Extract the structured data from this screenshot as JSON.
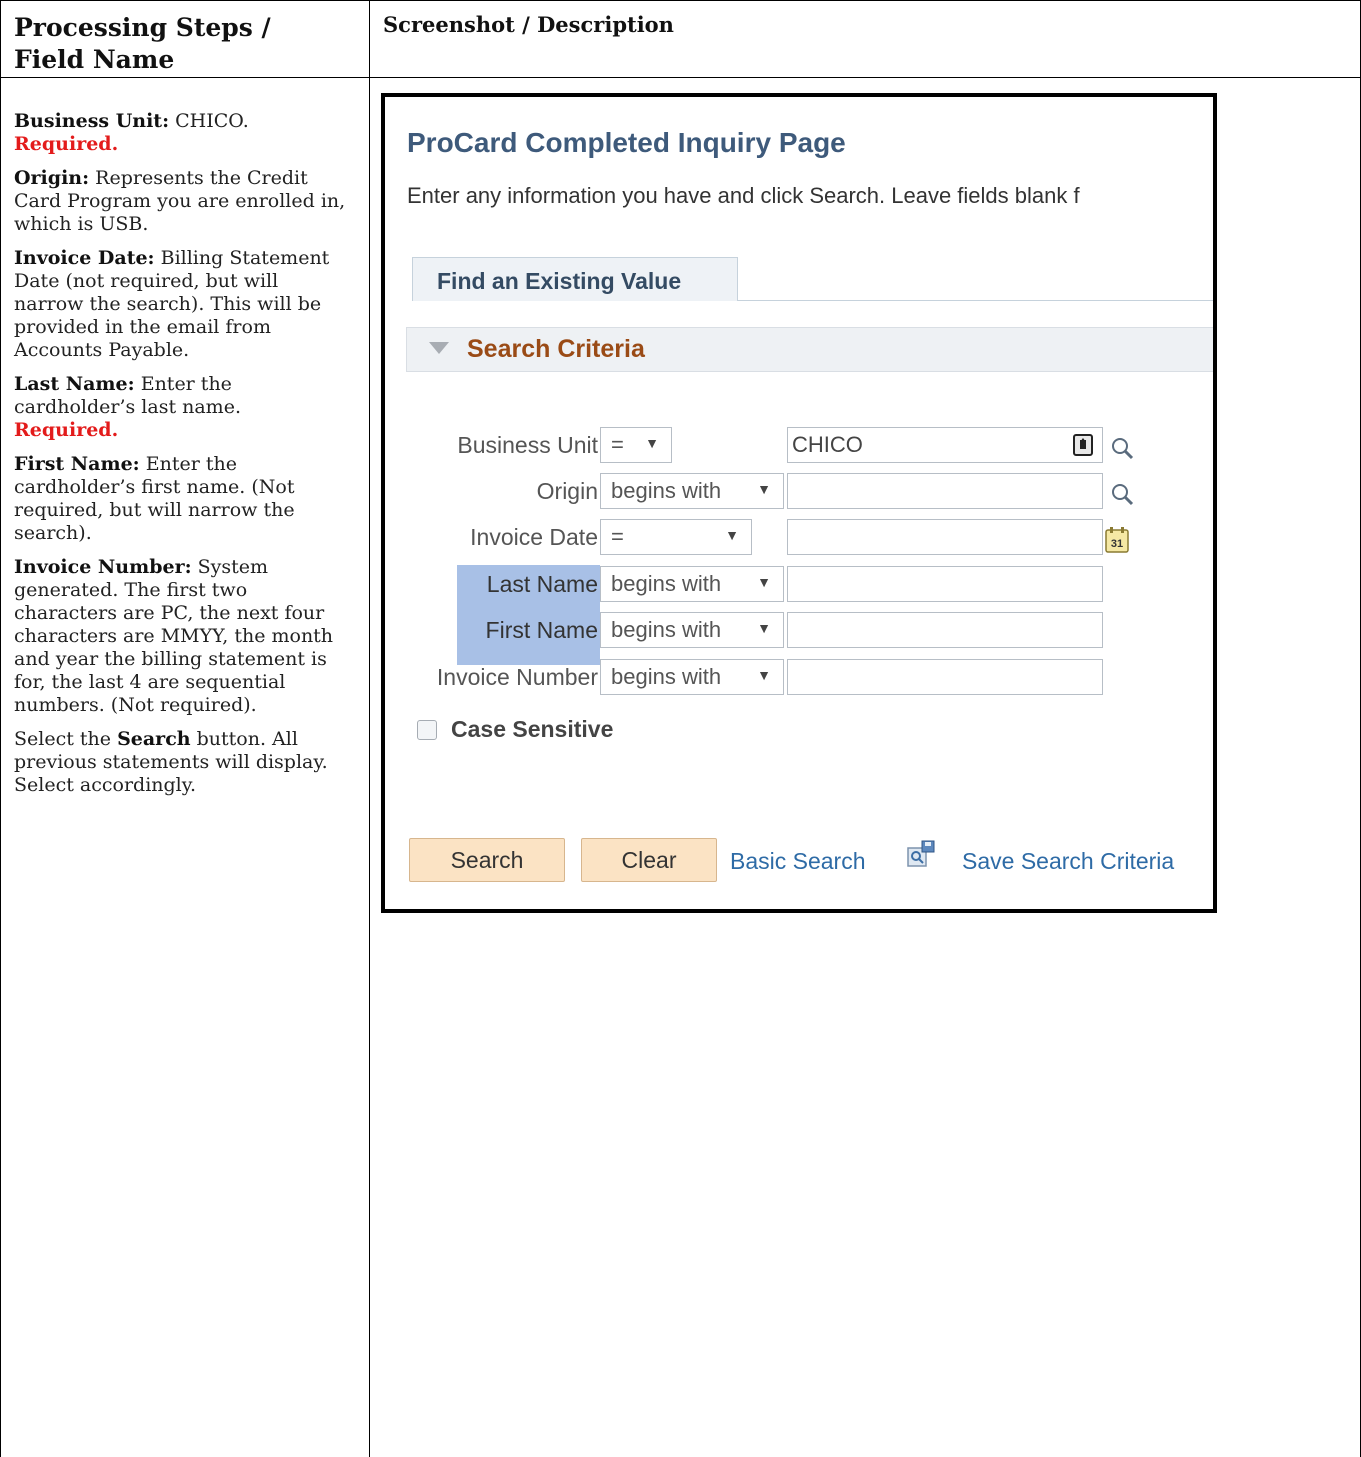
{
  "doc": {
    "col1_header": "Processing Steps / Field Name",
    "col2_header": "Screenshot / Description",
    "notes": [
      {
        "label": "Business Unit:",
        "text": " CHICO.",
        "required": "Required."
      },
      {
        "label": "Origin:",
        "text": " Represents the Credit Card Program you are enrolled in, which is USB.",
        "required": ""
      },
      {
        "label": "Invoice Date:",
        "text": "  Billing Statement Date (not required, but will narrow the search). This will be provided in the email from Accounts Payable.",
        "required": ""
      },
      {
        "label": "Last Name:",
        "text": " Enter the cardholder’s last name.",
        "required": "Required."
      },
      {
        "label": "First Name:",
        "text": "  Enter the cardholder’s first name. (Not required, but will narrow the search).",
        "required": ""
      },
      {
        "label": "Invoice Number:",
        "text": " System generated. The first two characters are PC, the next four characters are MMYY, the month and year the billing statement is for, the last 4 are sequential numbers. (Not required).",
        "required": ""
      }
    ],
    "final_note": {
      "pre": "Select the ",
      "bold": "Search",
      "post": " button.  All previous statements will display.  Select accordingly."
    }
  },
  "screenshot": {
    "page_title": "ProCard Completed Inquiry Page",
    "instructions": "Enter any information you have and click Search. Leave fields blank f",
    "tab_label": "Find an Existing Value",
    "section_label": "Search Criteria",
    "fields": [
      {
        "label": "Business Unit",
        "operator": "=",
        "value": ""
      },
      {
        "label": "Origin",
        "operator": "begins with",
        "value": ""
      },
      {
        "label": "Invoice Date",
        "operator": "=",
        "value": ""
      },
      {
        "label": "Last Name",
        "operator": "begins with",
        "value": ""
      },
      {
        "label": "First Name",
        "operator": "begins with",
        "value": ""
      },
      {
        "label": "Invoice Number",
        "operator": "begins with",
        "value": ""
      }
    ],
    "business_unit_value": "CHICO",
    "case_sensitive_label": "Case Sensitive",
    "search_button": "Search",
    "clear_button": "Clear",
    "basic_search_link": "Basic Search",
    "save_search_link": "Save Search Criteria",
    "calendar_glyph": "31",
    "arrow_glyph": "▼",
    "colors": {
      "title": "#3e5a7b",
      "section": "#9a4b16",
      "link": "#2e6ba6",
      "button": "#fbe3c4",
      "required": "#e31b1b",
      "highlight": "#a8c0e6"
    }
  }
}
